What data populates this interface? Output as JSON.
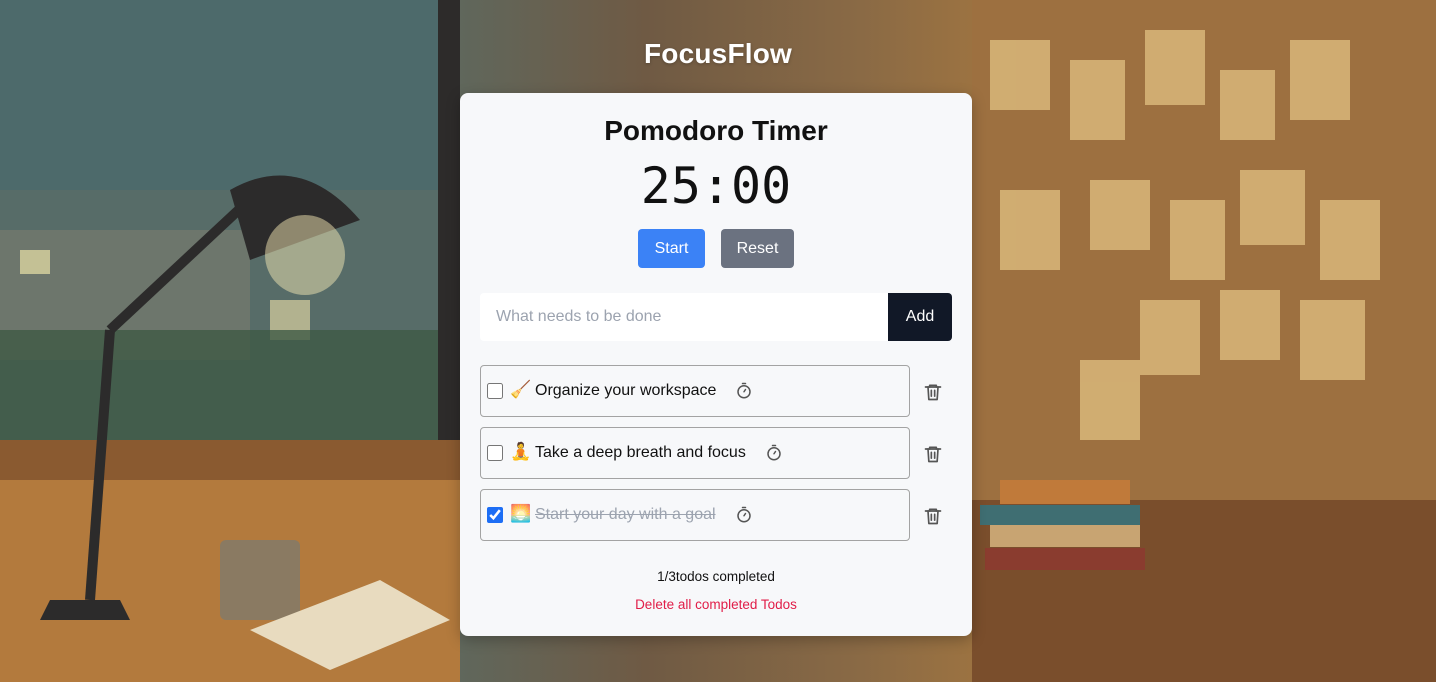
{
  "app": {
    "title": "FocusFlow"
  },
  "timer": {
    "title": "Pomodoro Timer",
    "display": "25:00",
    "start_label": "Start",
    "reset_label": "Reset"
  },
  "todo_input": {
    "placeholder": "What needs to be done",
    "value": "",
    "add_label": "Add"
  },
  "todos": [
    {
      "emoji": "🧹",
      "text": "Organize your workspace",
      "completed": false
    },
    {
      "emoji": "🧘",
      "text": "Take a deep breath and focus",
      "completed": false
    },
    {
      "emoji": "🌅",
      "text": "Start your day with a goal",
      "completed": true
    }
  ],
  "summary": {
    "text": "1/3todos completed",
    "delete_completed_label": "Delete all completed Todos"
  },
  "colors": {
    "start_button": "#3b82f6",
    "reset_button": "#6b7280",
    "add_button": "#111827",
    "delete_link": "#e11d48"
  }
}
